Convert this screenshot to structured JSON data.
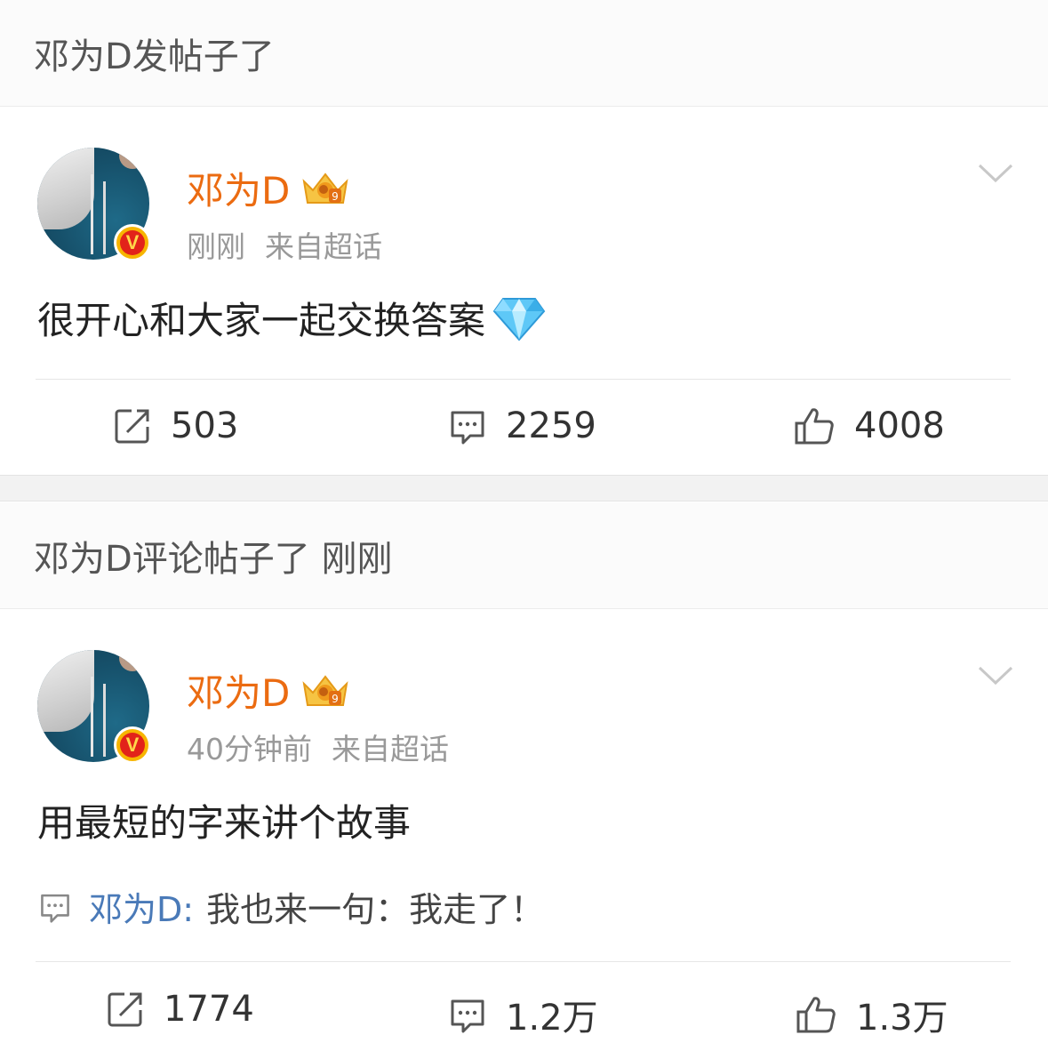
{
  "post1": {
    "header": "邓为D发帖子了",
    "username": "邓为D",
    "time": "刚刚",
    "source": "来自超话",
    "content": "很开心和大家一起交换答案",
    "reposts": "503",
    "comments": "2259",
    "likes": "4008"
  },
  "post2": {
    "header": "邓为D评论帖子了 刚刚",
    "username": "邓为D",
    "time": "40分钟前",
    "source": "来自超话",
    "content": "用最短的字来讲个故事",
    "comment_author": "邓为D:",
    "comment_text": "我也来一句：我走了！",
    "reposts": "1774",
    "comments": "1.2万",
    "likes": "1.3万"
  },
  "colors": {
    "username": "#eb6b11",
    "comment_author": "#4a7ab8",
    "verified_badge": "#e2231a"
  },
  "icons": {
    "verified": "verified-v-icon",
    "crown": "crown-level-9-icon",
    "diamond": "diamond-emoji",
    "repost": "share-icon",
    "comment": "comment-icon",
    "like": "thumbs-up-icon",
    "more": "chevron-down-icon"
  }
}
